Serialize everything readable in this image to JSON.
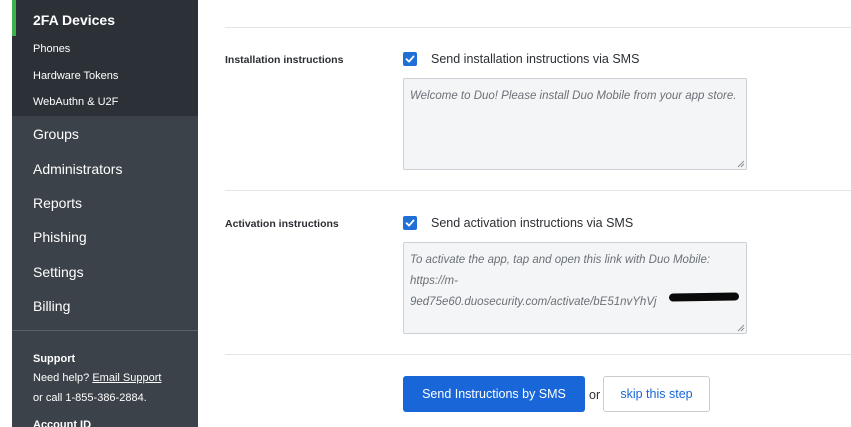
{
  "sidebar": {
    "active_section": {
      "title": "2FA Devices",
      "items": [
        "Phones",
        "Hardware Tokens",
        "WebAuthn & U2F"
      ]
    },
    "items": [
      "Groups",
      "Administrators",
      "Reports",
      "Phishing",
      "Settings",
      "Billing"
    ],
    "support": {
      "title": "Support",
      "need_help": "Need help?",
      "email_link": "Email Support",
      "call": "or call 1-855-386-2884.",
      "account_id_label": "Account ID"
    }
  },
  "installation": {
    "label": "Installation instructions",
    "checkbox_label": "Send installation instructions via SMS",
    "checked": true,
    "message": "Welcome to Duo! Please install Duo Mobile from your app store."
  },
  "activation": {
    "label": "Activation instructions",
    "checkbox_label": "Send activation instructions via SMS",
    "checked": true,
    "message_line1": "To activate the app, tap and open this link with Duo Mobile:",
    "message_line2": "https://m-",
    "message_line3": "9ed75e60.duosecurity.com/activate/bE51nvYhVj"
  },
  "actions": {
    "primary": "Send Instructions by SMS",
    "or": "or",
    "secondary": "skip this step"
  },
  "colors": {
    "sidebar_bg": "#3b4249",
    "active_bg": "#2c3137",
    "accent_green": "#3fb14b",
    "primary_blue": "#1866d8"
  }
}
